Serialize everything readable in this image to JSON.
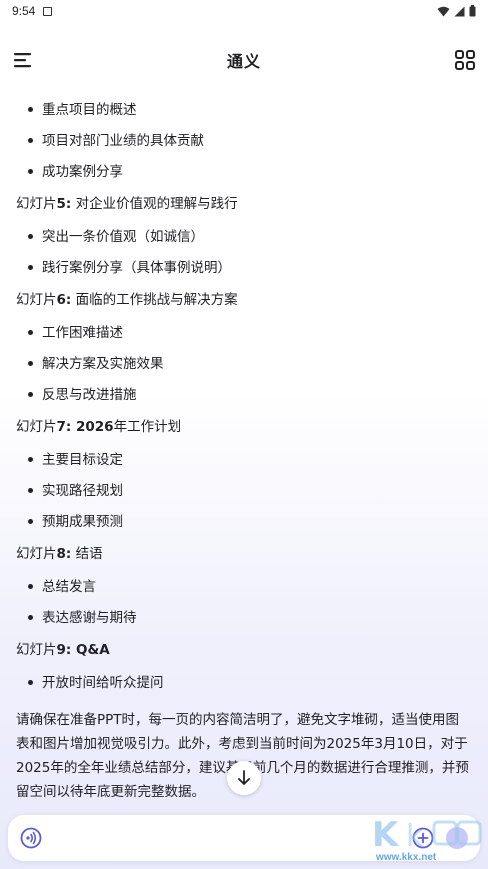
{
  "status_bar": {
    "time": "9:54"
  },
  "header": {
    "title": "通义"
  },
  "content": {
    "top_bullets": [
      "重点项目的概述",
      "项目对部门业绩的具体贡献",
      "成功案例分享"
    ],
    "slides": [
      {
        "label": "幻灯片",
        "num": "5:",
        "title": " 对企业价值观的理解与践行",
        "bullets": [
          "突出一条价值观（如诚信）",
          "践行案例分享（具体事例说明）"
        ]
      },
      {
        "label": "幻灯片",
        "num": "6:",
        "title": " 面临的工作挑战与解决方案",
        "bullets": [
          "工作困难描述",
          "解决方案及实施效果",
          "反思与改进措施"
        ]
      },
      {
        "label": "幻灯片",
        "num": "7: 2026",
        "title": "年工作计划",
        "bullets": [
          "主要目标设定",
          "实现路径规划",
          "预期成果预测"
        ]
      },
      {
        "label": "幻灯片",
        "num": "8:",
        "title": " 结语",
        "bullets": [
          "总结发言",
          "表达感谢与期待"
        ]
      },
      {
        "label": "幻灯片",
        "num": "9: Q&A",
        "title": "",
        "bullets": [
          "开放时间给听众提问"
        ]
      }
    ],
    "paragraph": "请确保在准备PPT时，每一页的内容简洁明了，避免文字堆砌，适当使用图表和图片增加视觉吸引力。此外，考虑到当前时间为2025年3月10日，对于2025年的全年业绩总结部分，建议基于前几个月的数据进行合理推测，并预留空间以待年底更新完整数据。"
  },
  "input_bar": {
    "placeholder": ""
  },
  "watermark": {
    "text": "www.kkx.net"
  },
  "colors": {
    "accent": "#5b5bd6",
    "send_button": "#c9c8f6",
    "watermark": "#63a7e6"
  }
}
